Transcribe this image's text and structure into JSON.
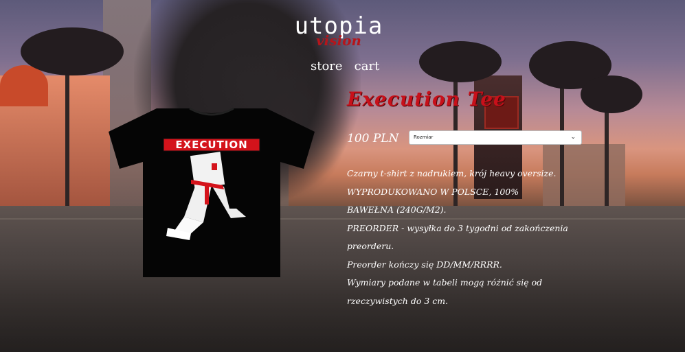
{
  "brand": {
    "name": "utopia",
    "tagline": "vision"
  },
  "nav": {
    "store": "store",
    "cart": "cart"
  },
  "product": {
    "title": "Execution Tee",
    "price": "100 PLN",
    "size_select": {
      "value": "Rozmiar"
    },
    "print_text": "EXECUTION",
    "description": [
      "Czarny t-shirt z nadrukiem, krój heavy oversize.",
      "WYPRODUKOWANO W POLSCE, 100%",
      "BAWEŁNA (240G/M2).",
      "PREORDER - wysyłka do 3 tygodni od zakończenia",
      "preorderu.",
      "Preorder kończy się DD/MM/RRRR.",
      "Wymiary podane w tabeli mogą różnić się od",
      "rzeczywistych do 3 cm."
    ]
  },
  "colors": {
    "title_red": "#c8101a",
    "brand_red": "#b5151b",
    "text": "#ffffff"
  },
  "icons": {
    "select_arrow": "chevron-down-icon"
  }
}
